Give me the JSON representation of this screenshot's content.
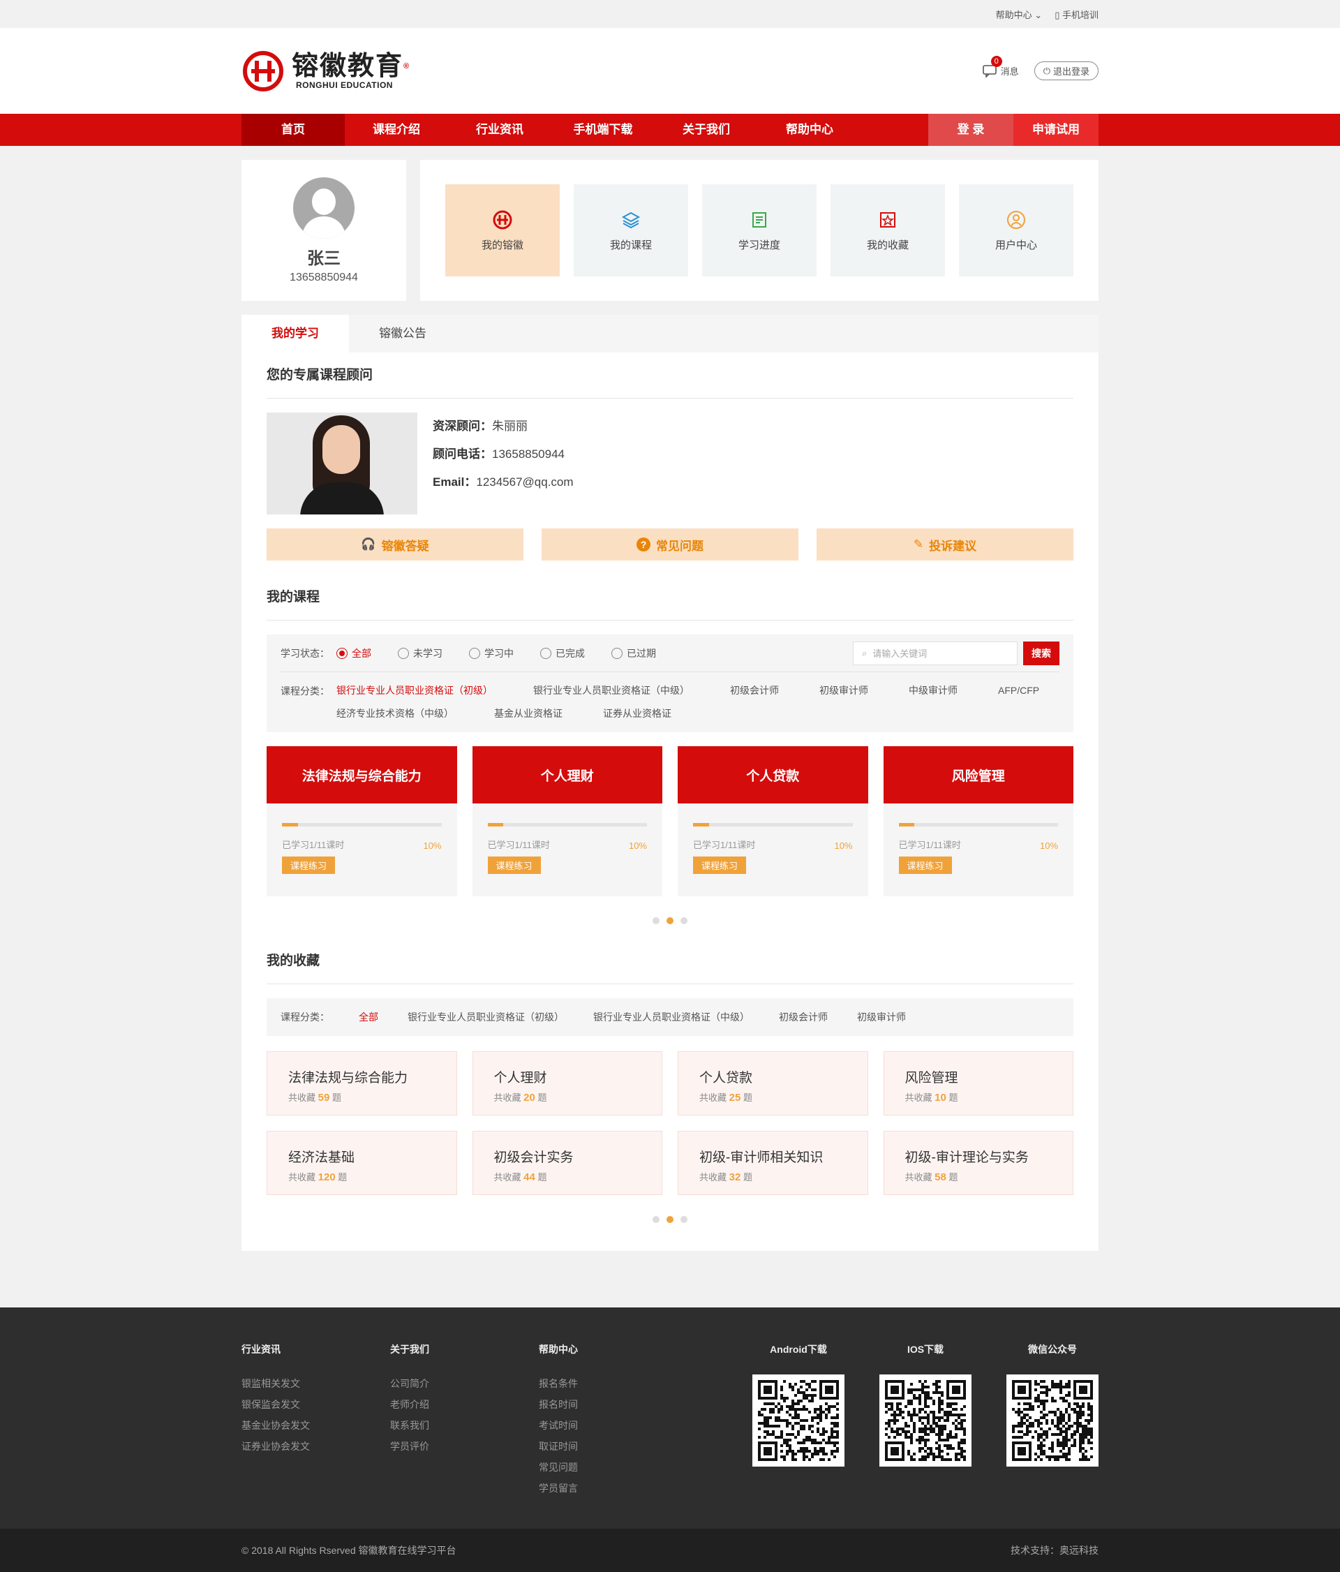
{
  "topbar": {
    "help": "帮助中心",
    "mobile": "手机培训"
  },
  "header": {
    "logo_text": "镕徽教育",
    "logo_sub": "RONGHUI EDUCATION",
    "logo_mark": "®",
    "message_label": "消息",
    "message_count": "0",
    "logout_label": "退出登录"
  },
  "nav": {
    "items": [
      "首页",
      "课程介绍",
      "行业资讯",
      "手机端下载",
      "关于我们",
      "帮助中心"
    ],
    "login": "登  录",
    "trial": "申请试用"
  },
  "user": {
    "name": "张三",
    "phone": "13658850944"
  },
  "menu": [
    {
      "label": "我的镕徽",
      "icon": "logo-icon"
    },
    {
      "label": "我的课程",
      "icon": "layers-icon"
    },
    {
      "label": "学习进度",
      "icon": "progress-icon"
    },
    {
      "label": "我的收藏",
      "icon": "star-icon"
    },
    {
      "label": "用户中心",
      "icon": "user-icon"
    }
  ],
  "tabs": [
    "我的学习",
    "镕徽公告"
  ],
  "advisor": {
    "section_title": "您的专属课程顾问",
    "name_label": "资深顾问：",
    "name": "朱丽丽",
    "phone_label": "顾问电话：",
    "phone": "13658850944",
    "email_label": "Email：",
    "email": "1234567@qq.com"
  },
  "help_buttons": [
    "镕徽答疑",
    "常见问题",
    "投诉建议"
  ],
  "courses_section": {
    "title": "我的课程",
    "status_label": "学习状态：",
    "statuses": [
      "全部",
      "未学习",
      "学习中",
      "已完成",
      "已过期"
    ],
    "search_placeholder": "请输入关键词",
    "search_btn": "搜索",
    "category_label": "课程分类：",
    "categories": [
      "银行业专业人员职业资格证（初级）",
      "银行业专业人员职业资格证（中级）",
      "初级会计师",
      "初级审计师",
      "中级审计师",
      "AFP/CFP",
      "经济专业技术资格（中级）",
      "基金从业资格证",
      "证券从业资格证"
    ]
  },
  "courses": [
    {
      "title": "法律法规与综合能力",
      "progress_text": "已学习1/11课时",
      "percent": "10%",
      "practice": "课程练习",
      "progress": 0.1
    },
    {
      "title": "个人理财",
      "progress_text": "已学习1/11课时",
      "percent": "10%",
      "practice": "课程练习",
      "progress": 0.1
    },
    {
      "title": "个人贷款",
      "progress_text": "已学习1/11课时",
      "percent": "10%",
      "practice": "课程练习",
      "progress": 0.1
    },
    {
      "title": "风险管理",
      "progress_text": "已学习1/11课时",
      "percent": "10%",
      "practice": "课程练习",
      "progress": 0.1
    }
  ],
  "favorites_section": {
    "title": "我的收藏",
    "category_label": "课程分类：",
    "categories": [
      "全部",
      "银行业专业人员职业资格证（初级）",
      "银行业专业人员职业资格证（中级）",
      "初级会计师",
      "初级审计师"
    ]
  },
  "favorites": [
    {
      "title": "法律法规与综合能力",
      "prefix": "共收藏",
      "count": "59",
      "suffix": "题"
    },
    {
      "title": "个人理财",
      "prefix": "共收藏",
      "count": "20",
      "suffix": "题"
    },
    {
      "title": "个人贷款",
      "prefix": "共收藏",
      "count": "25",
      "suffix": "题"
    },
    {
      "title": "风险管理",
      "prefix": "共收藏",
      "count": "10",
      "suffix": "题"
    },
    {
      "title": "经济法基础",
      "prefix": "共收藏",
      "count": "120",
      "suffix": "题"
    },
    {
      "title": "初级会计实务",
      "prefix": "共收藏",
      "count": "44",
      "suffix": "题"
    },
    {
      "title": "初级-审计师相关知识",
      "prefix": "共收藏",
      "count": "32",
      "suffix": "题"
    },
    {
      "title": "初级-审计理论与实务",
      "prefix": "共收藏",
      "count": "58",
      "suffix": "题"
    }
  ],
  "footer": {
    "columns": [
      {
        "title": "行业资讯",
        "links": [
          "银监相关发文",
          "银保监会发文",
          "基金业协会发文",
          "证券业协会发文"
        ]
      },
      {
        "title": "关于我们",
        "links": [
          "公司简介",
          "老师介绍",
          "联系我们",
          "学员评价"
        ]
      },
      {
        "title": "帮助中心",
        "links": [
          "报名条件",
          "报名时间",
          "考试时间",
          "取证时间",
          "常见问题",
          "学员留言"
        ]
      }
    ],
    "qrcodes": [
      "Android下载",
      "IOS下载",
      "微信公众号"
    ],
    "copyright": "© 2018 All Rights Rserved  镕徽教育在线学习平台",
    "support": "技术支持：奥远科技"
  },
  "colors": {
    "brand_red": "#d40c0c",
    "accent_orange": "#f0a23a",
    "tile_peach": "#fbdfc2"
  }
}
